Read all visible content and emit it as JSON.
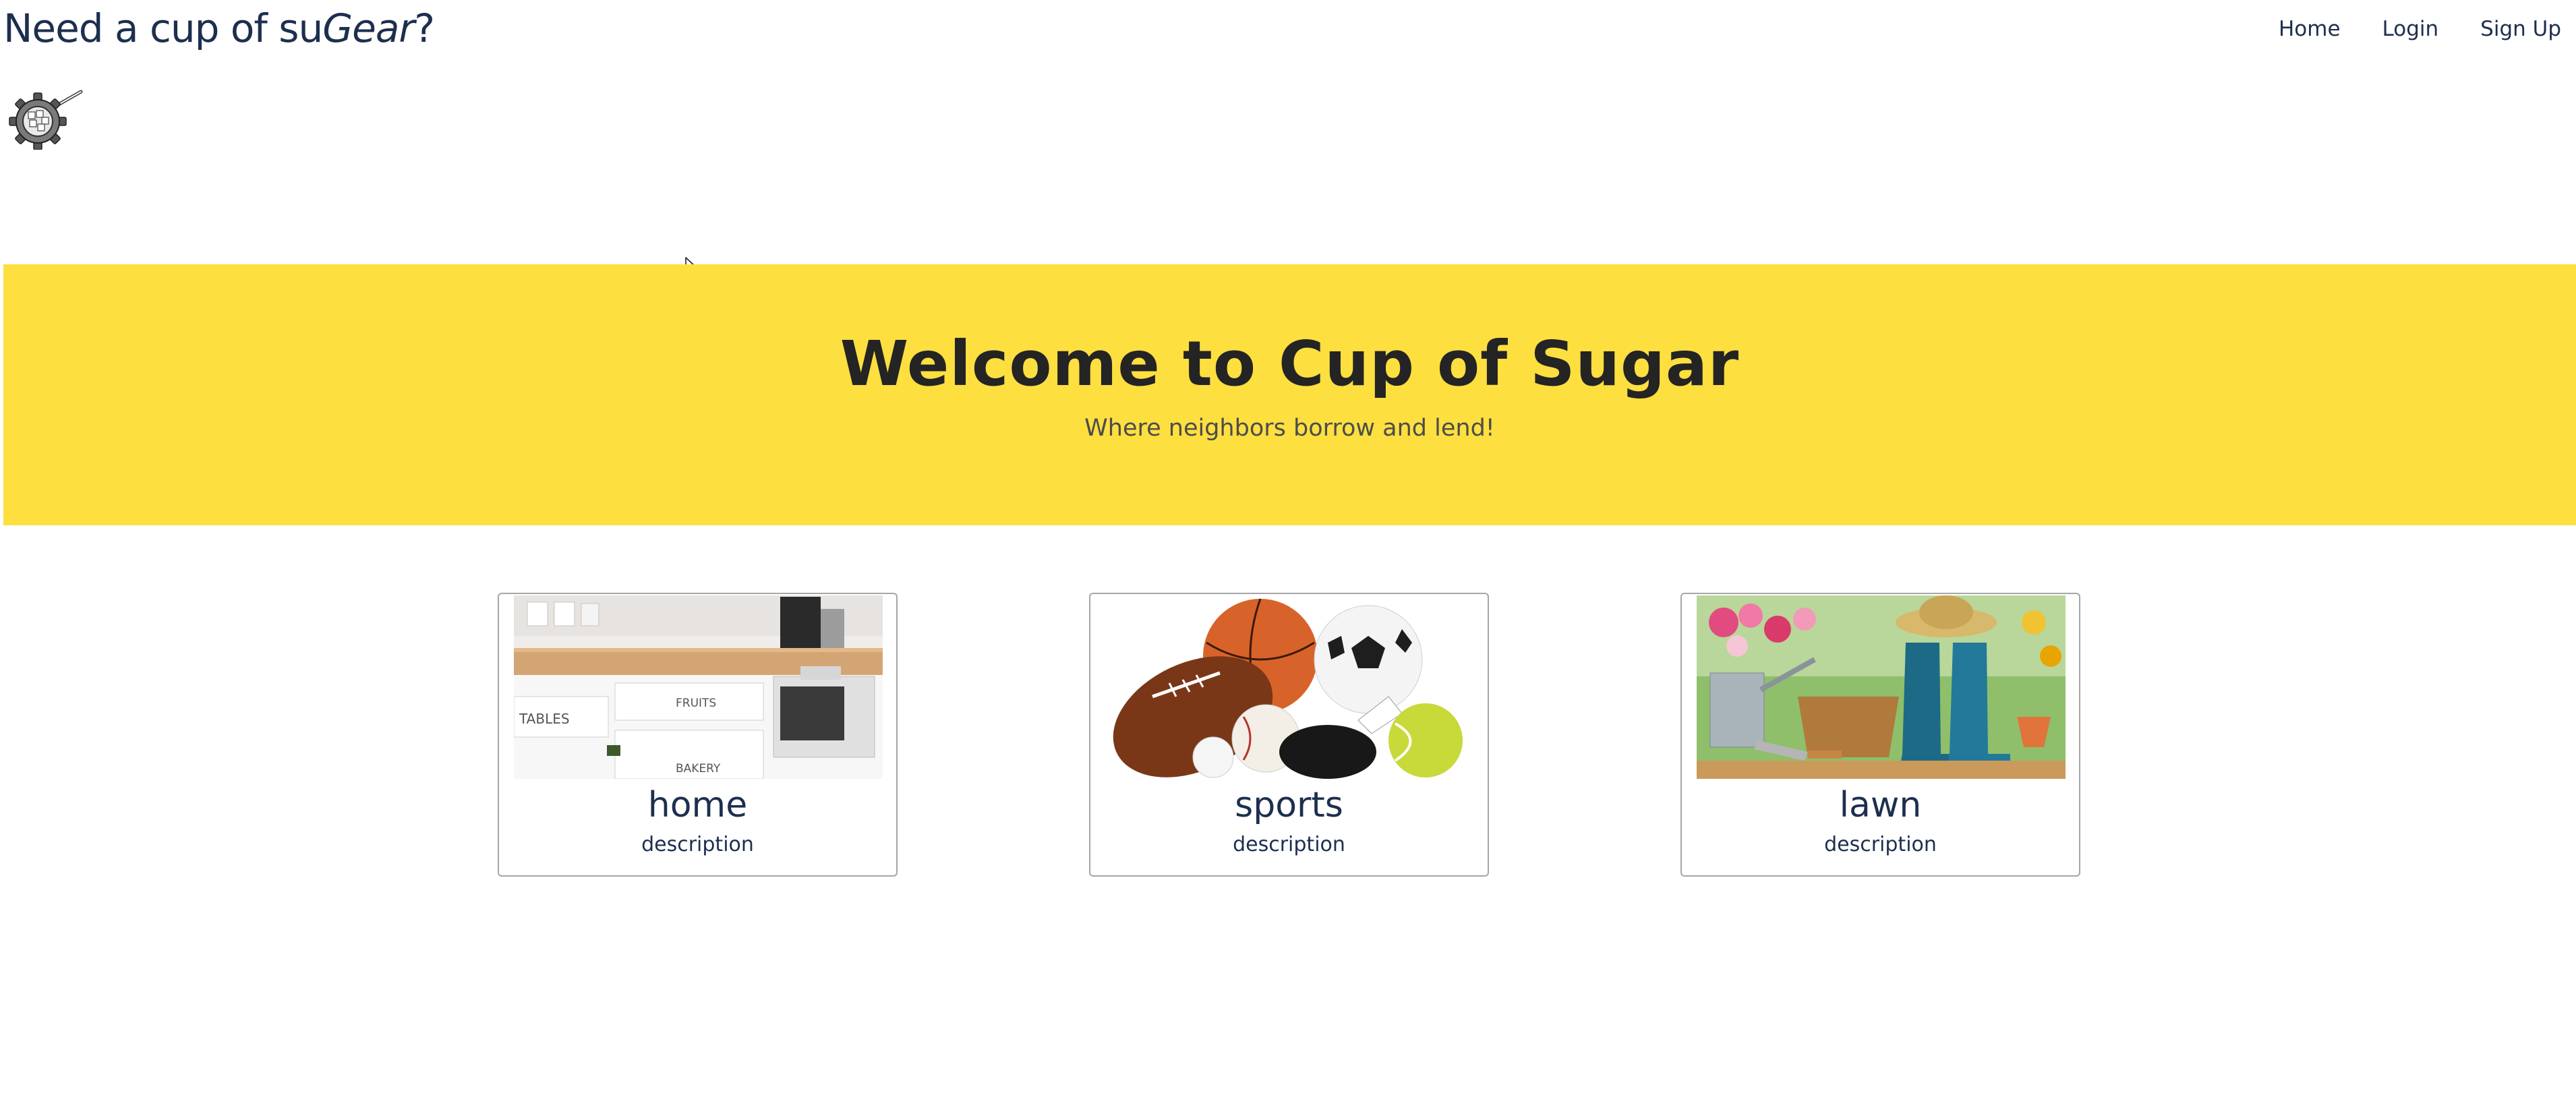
{
  "navbar": {
    "brand_prefix": "Need a cup of su",
    "brand_italic": "Gear",
    "brand_suffix": "?",
    "links": [
      {
        "label": "Home"
      },
      {
        "label": "Login"
      },
      {
        "label": "Sign Up"
      }
    ]
  },
  "hero": {
    "title": "Welcome to Cup of Sugar",
    "subtitle": "Where neighbors borrow and lend!",
    "background_color": "#fddf40"
  },
  "categories": [
    {
      "title": "home",
      "description": "description",
      "image": "home-storage-photo"
    },
    {
      "title": "sports",
      "description": "description",
      "image": "sports-balls-photo"
    },
    {
      "title": "lawn",
      "description": "description",
      "image": "garden-tools-photo"
    }
  ],
  "colors": {
    "text_navy": "#1d2f4f",
    "card_border": "#a6a6a6"
  }
}
